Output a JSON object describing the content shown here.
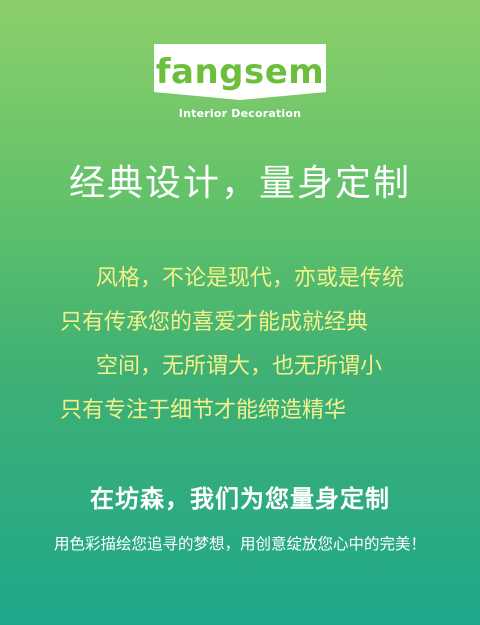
{
  "brand": {
    "name": "fangsem",
    "subtitle": "Interior Decoration",
    "accent": "#6bbf3c",
    "plate": "#ffffff"
  },
  "headline": "经典设计，量身定制",
  "poem": {
    "lines": [
      "风格，不论是现代，亦或是传统",
      "只有传承您的喜爱才能成就经典",
      "空间，无所谓大，也无所谓小",
      "只有专注于细节才能缔造精华"
    ],
    "color": "#f5f18a"
  },
  "slogan": "在坊森，我们为您量身定制",
  "tagline": "用色彩描绘您追寻的梦想，用创意绽放您心中的完美！",
  "background": {
    "top": "#8ccf6a",
    "bottom": "#1fa78a"
  }
}
